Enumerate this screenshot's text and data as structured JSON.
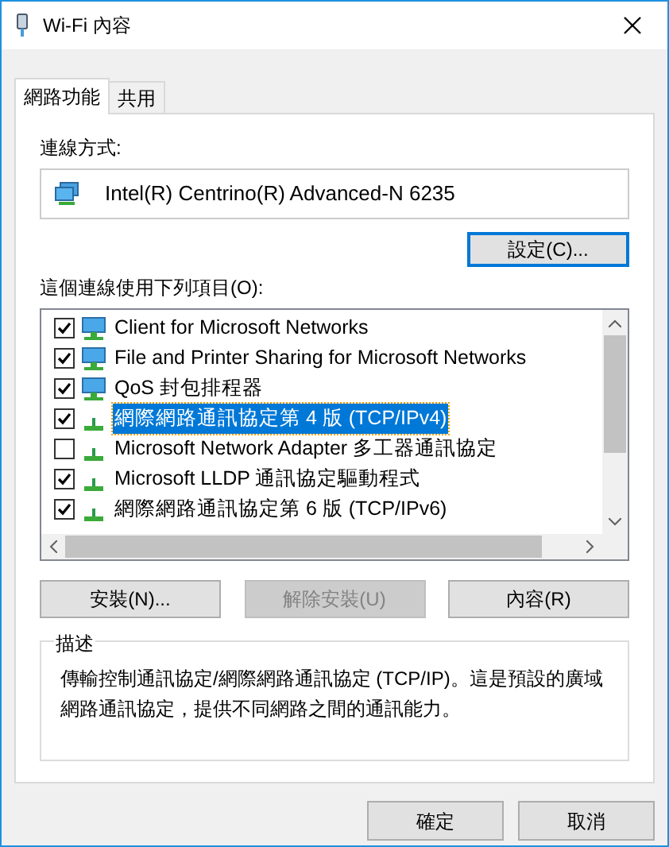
{
  "window": {
    "title": "Wi-Fi 內容"
  },
  "tabs": [
    {
      "label": "網路功能",
      "selected": true
    },
    {
      "label": "共用",
      "selected": false
    }
  ],
  "connect_using": {
    "label": "連線方式:",
    "adapter": "Intel(R) Centrino(R) Advanced-N 6235",
    "configure_button": "設定(C)..."
  },
  "items_label": "這個連線使用下列項目(O):",
  "items": [
    {
      "label": "Client for Microsoft Networks",
      "checked": true,
      "selected": false,
      "kind": "monitor"
    },
    {
      "label": "File and Printer Sharing for Microsoft Networks",
      "checked": true,
      "selected": false,
      "kind": "monitor"
    },
    {
      "label": "QoS 封包排程器",
      "checked": true,
      "selected": false,
      "kind": "monitor"
    },
    {
      "label": "網際網路通訊協定第 4 版 (TCP/IPv4)",
      "checked": true,
      "selected": true,
      "kind": "protocol"
    },
    {
      "label": "Microsoft Network Adapter 多工器通訊協定",
      "checked": false,
      "selected": false,
      "kind": "protocol"
    },
    {
      "label": "Microsoft LLDP 通訊協定驅動程式",
      "checked": true,
      "selected": false,
      "kind": "protocol"
    },
    {
      "label": "網際網路通訊協定第 6 版 (TCP/IPv6)",
      "checked": true,
      "selected": false,
      "kind": "protocol"
    }
  ],
  "item_buttons": [
    {
      "label": "安裝(N)...",
      "disabled": false
    },
    {
      "label": "解除安裝(U)",
      "disabled": true
    },
    {
      "label": "內容(R)",
      "disabled": false
    }
  ],
  "description": {
    "title": "描述",
    "text": "傳輸控制通訊協定/網際網路通訊協定 (TCP/IP)。這是預設的廣域網路通訊協定，提供不同網路之間的通訊能力。"
  },
  "dialog_buttons": [
    "確定",
    "取消"
  ]
}
